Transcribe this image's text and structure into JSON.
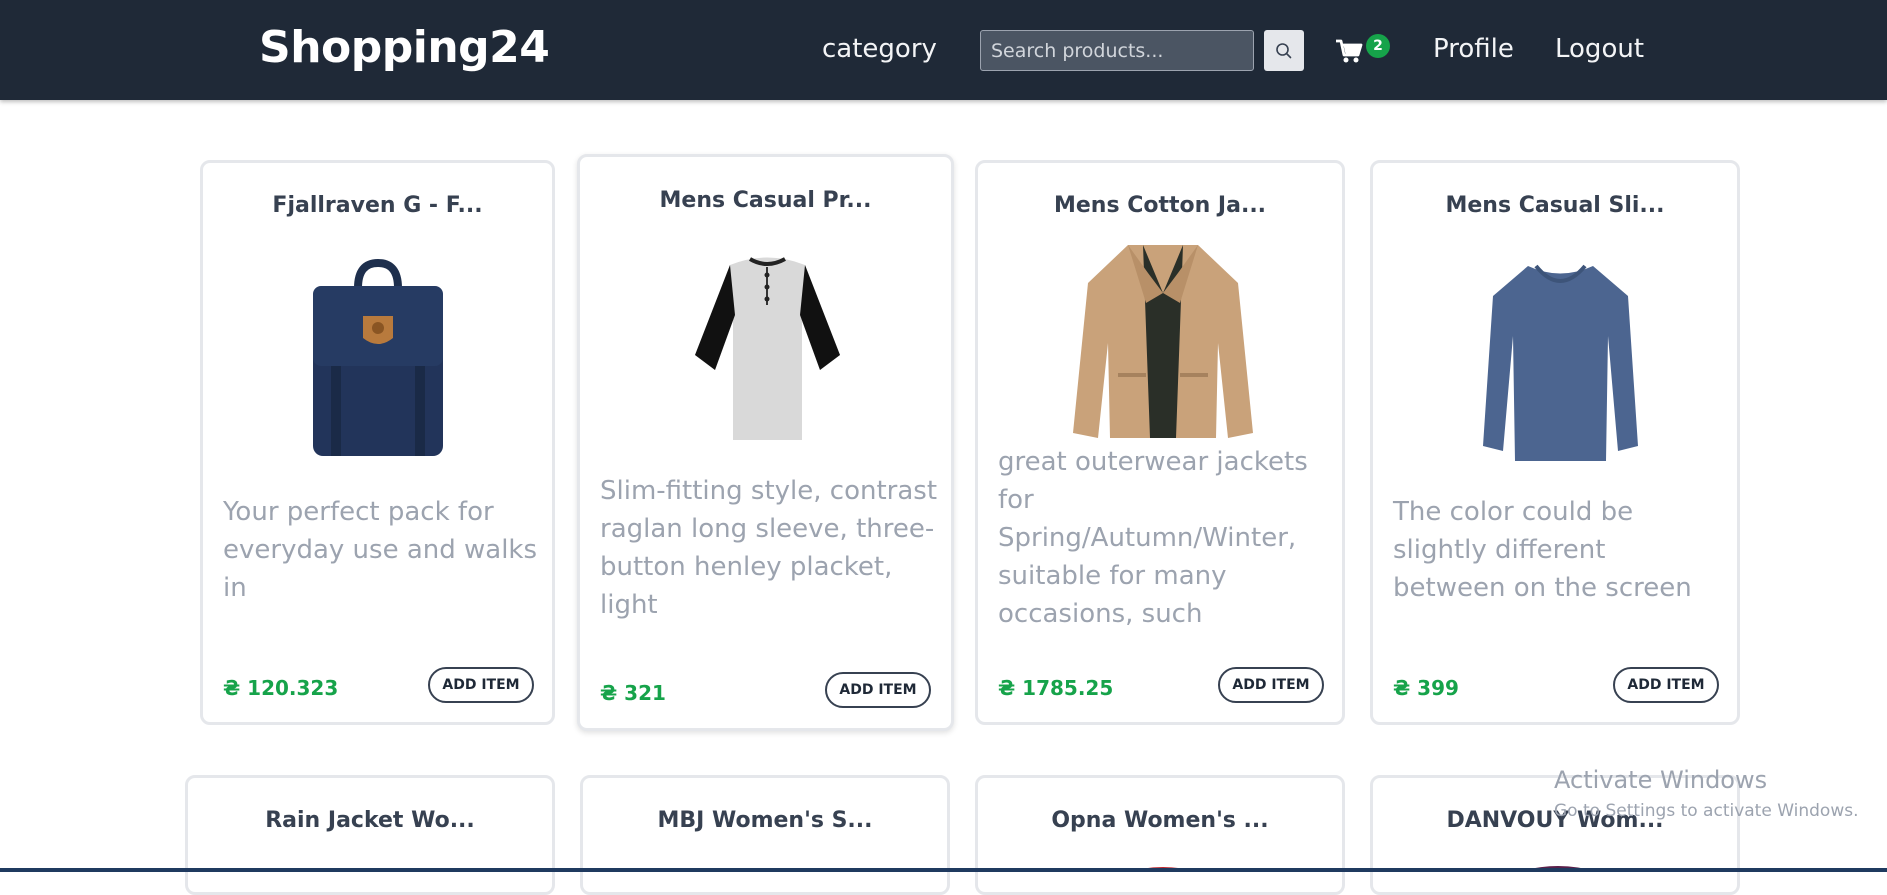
{
  "navbar": {
    "brand": "Shopping24",
    "category_label": "category",
    "search_placeholder": "Search products...",
    "cart_count": "2",
    "profile_label": "Profile",
    "logout_label": "Logout"
  },
  "products": [
    {
      "title": "Fjallraven G - F...",
      "description": "Your perfect pack for everyday use and walks in",
      "price": "₴ 120.323",
      "button": "ADD ITEM",
      "image": "navy-backpack"
    },
    {
      "title": "Mens Casual Pr...",
      "description": "Slim-fitting style, contrast raglan long sleeve, three-button henley placket, light",
      "price": "₴ 321",
      "button": "ADD ITEM",
      "image": "raglan-henley-shirt"
    },
    {
      "title": "Mens Cotton Ja...",
      "description": "great outerwear jackets for Spring/Autumn/Winter, suitable for many occasions, such",
      "price": "₴ 1785.25",
      "button": "ADD ITEM",
      "image": "khaki-cotton-jacket"
    },
    {
      "title": "Mens Casual Sli...",
      "description": "The color could be slightly different between on the screen",
      "price": "₴ 399",
      "button": "ADD ITEM",
      "image": "blue-long-sleeve-tee"
    }
  ],
  "products_row2": [
    {
      "title": "Rain Jacket Wo..."
    },
    {
      "title": "MBJ Women's S..."
    },
    {
      "title": "Opna Women's ..."
    },
    {
      "title": "DANVOUY Wom..."
    }
  ],
  "watermark": {
    "title": "Activate Windows",
    "subtitle": "Go to Settings to activate Windows."
  },
  "colors": {
    "navbar_bg": "#1f2937",
    "price_green": "#16a34a",
    "badge_green": "#16a34a",
    "description_gray": "#9ca3af"
  },
  "icons": [
    "search-icon",
    "cart-icon"
  ]
}
